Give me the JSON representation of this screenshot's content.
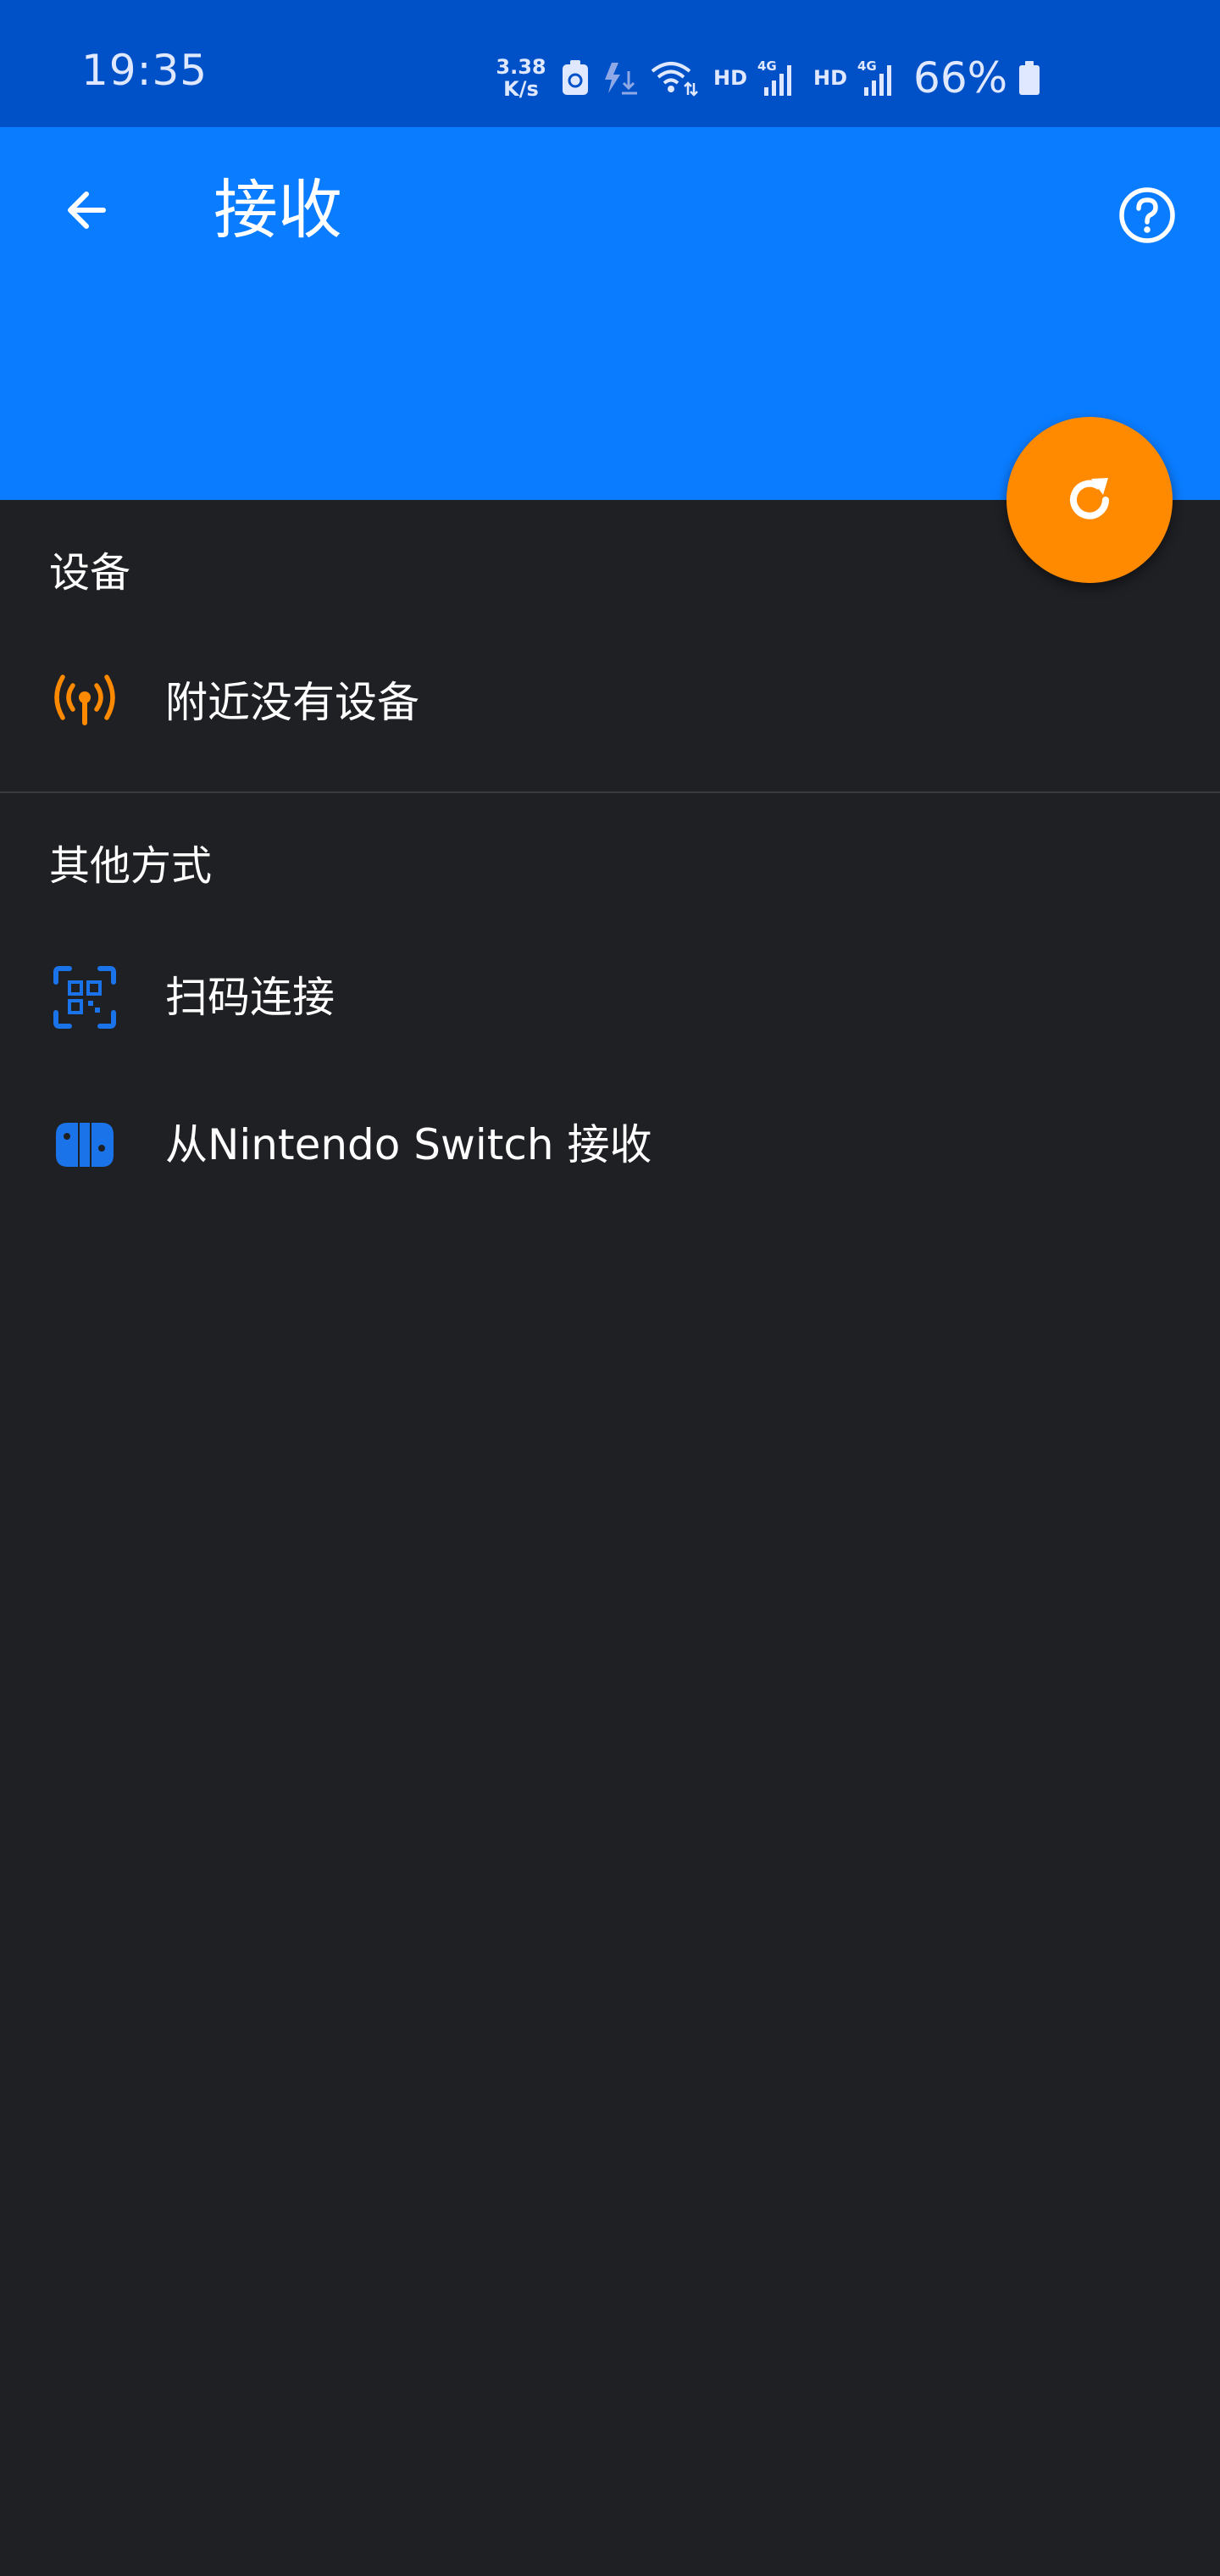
{
  "status_bar": {
    "time": "19:35",
    "net_speed_value": "3.38",
    "net_speed_unit": "K/s",
    "hd1": "HD",
    "hd2": "HD",
    "network1": "4G",
    "network2": "4G",
    "battery": "66%"
  },
  "app_bar": {
    "title": "接收",
    "back_icon": "arrow-left-icon",
    "help_icon": "help-circle-icon"
  },
  "fab": {
    "icon": "refresh-icon",
    "color": "#ff8a00"
  },
  "sections": {
    "devices": {
      "header": "设备",
      "empty_label": "附近没有设备",
      "empty_icon": "antenna-icon"
    },
    "other": {
      "header": "其他方式",
      "items": [
        {
          "label": "扫码连接",
          "icon": "qr-scan-icon"
        },
        {
          "label": "从Nintendo Switch 接收",
          "icon": "nintendo-switch-icon"
        }
      ]
    }
  },
  "colors": {
    "status_bar": "#0051c8",
    "app_bar": "#0a7cff",
    "background": "#1f2024",
    "accent_orange": "#ff8a00",
    "accent_blue": "#1a73e8"
  }
}
